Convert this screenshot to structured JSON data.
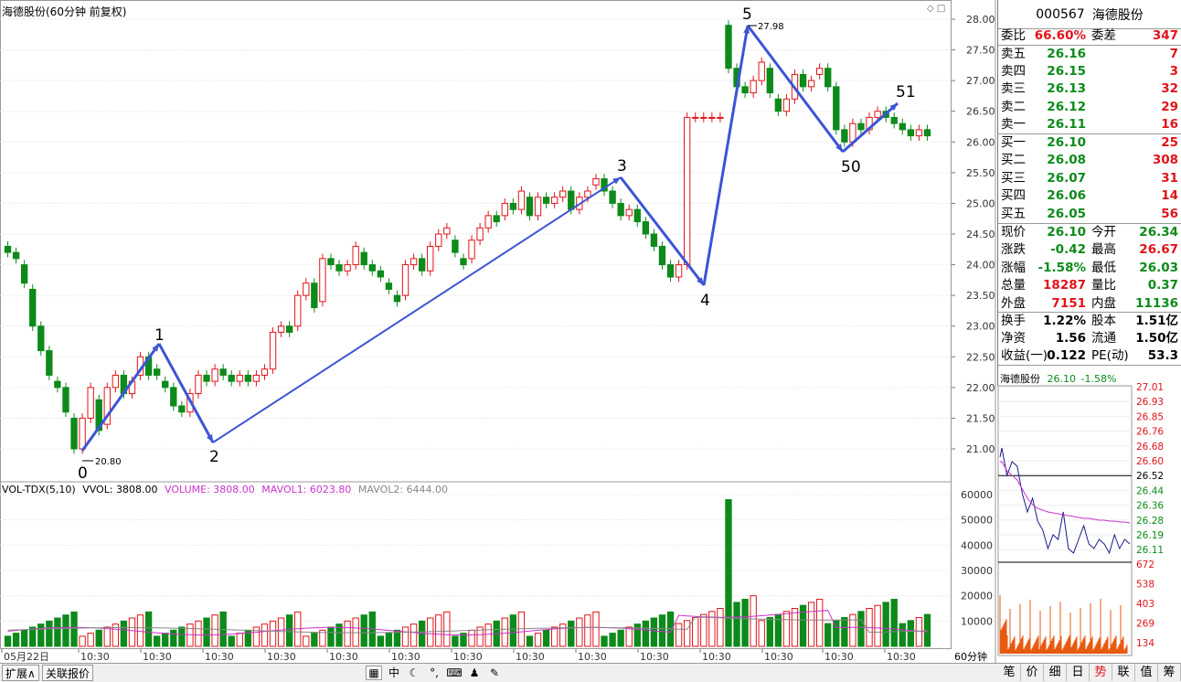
{
  "chart_title": "海德股份(60分钟 前复权)",
  "y_axis": [
    "28.00",
    "27.50",
    "27.00",
    "26.50",
    "26.00",
    "25.50",
    "25.00",
    "24.50",
    "24.00",
    "23.50",
    "23.00",
    "22.50",
    "22.00",
    "21.50",
    "21.00"
  ],
  "vol_axis": [
    "60000",
    "50000",
    "40000",
    "30000",
    "20000",
    "10000"
  ],
  "x_axis": [
    "05月22日",
    "10:30",
    "10:30",
    "10:30",
    "10:30",
    "10:30",
    "10:30",
    "10:30",
    "10:30",
    "10:30",
    "10:30",
    "10:30",
    "10:30",
    "10:30",
    "10:30",
    "10:30"
  ],
  "annotations": {
    "low_price": "20.80",
    "high_price": "27.98",
    "wave_labels": [
      "0",
      "1",
      "2",
      "3",
      "4",
      "5",
      "50",
      "51"
    ]
  },
  "volume_header": {
    "name": "VOL-TDX(5,10)",
    "vvol": "VVOL: 3808.00",
    "volume": "VOLUME: 3808.00",
    "mavol1": "MAVOL1: 6023.80",
    "mavol2": "MAVOL2: 6444.00"
  },
  "quote": {
    "code": "000567",
    "name": "海德股份",
    "weibi_label": "委比",
    "weibi": "66.60%",
    "weicha_label": "委差",
    "weicha": "347",
    "asks": [
      {
        "label": "卖五",
        "price": "26.16",
        "qty": "7"
      },
      {
        "label": "卖四",
        "price": "26.15",
        "qty": "3"
      },
      {
        "label": "卖三",
        "price": "26.13",
        "qty": "32"
      },
      {
        "label": "卖二",
        "price": "26.12",
        "qty": "29"
      },
      {
        "label": "卖一",
        "price": "26.11",
        "qty": "16"
      }
    ],
    "bids": [
      {
        "label": "买一",
        "price": "26.10",
        "qty": "25"
      },
      {
        "label": "买二",
        "price": "26.08",
        "qty": "308"
      },
      {
        "label": "买三",
        "price": "26.07",
        "qty": "31"
      },
      {
        "label": "买四",
        "price": "26.06",
        "qty": "14"
      },
      {
        "label": "买五",
        "price": "26.05",
        "qty": "56"
      }
    ],
    "stats": [
      {
        "l": "现价",
        "v": "26.10",
        "vc": "green",
        "l2": "今开",
        "v2": "26.34",
        "v2c": "green"
      },
      {
        "l": "涨跌",
        "v": "-0.42",
        "vc": "green",
        "l2": "最高",
        "v2": "26.67",
        "v2c": "red"
      },
      {
        "l": "涨幅",
        "v": "-1.58%",
        "vc": "green",
        "l2": "最低",
        "v2": "26.03",
        "v2c": "green"
      },
      {
        "l": "总量",
        "v": "18287",
        "vc": "red",
        "l2": "量比",
        "v2": "0.37",
        "v2c": "green"
      },
      {
        "l": "外盘",
        "v": "7151",
        "vc": "red",
        "l2": "内盘",
        "v2": "11136",
        "v2c": "green"
      }
    ],
    "fin": [
      {
        "l": "换手",
        "v": "1.22%",
        "l2": "股本",
        "v2": "1.51亿"
      },
      {
        "l": "净资",
        "v": "1.56",
        "l2": "流通",
        "v2": "1.50亿"
      },
      {
        "l": "收益(一)",
        "v": "0.122",
        "l2": "PE(动)",
        "v2": "53.3"
      }
    ]
  },
  "mini": {
    "name": "海德股份",
    "price": "26.10",
    "pct": "-1.58%",
    "axis": [
      "27.01",
      "26.93",
      "26.85",
      "26.76",
      "26.68",
      "26.60",
      "26.52",
      "26.44",
      "26.36",
      "26.28",
      "26.19",
      "26.11"
    ],
    "vol_axis": [
      "672",
      "538",
      "403",
      "269",
      "134"
    ]
  },
  "bottom": {
    "tab1": "扩展∧",
    "tab2": "关联报价",
    "period": "60分钟",
    "right_tabs": [
      "笔",
      "价",
      "细",
      "日",
      "势",
      "联",
      "值",
      "筹"
    ],
    "active_tab": "势"
  },
  "colors": {
    "up": "#e0141a",
    "down": "#0c8a1a",
    "wave": "#3b55d4",
    "ma1": "#cc33cc",
    "ma2": "#888888"
  }
}
